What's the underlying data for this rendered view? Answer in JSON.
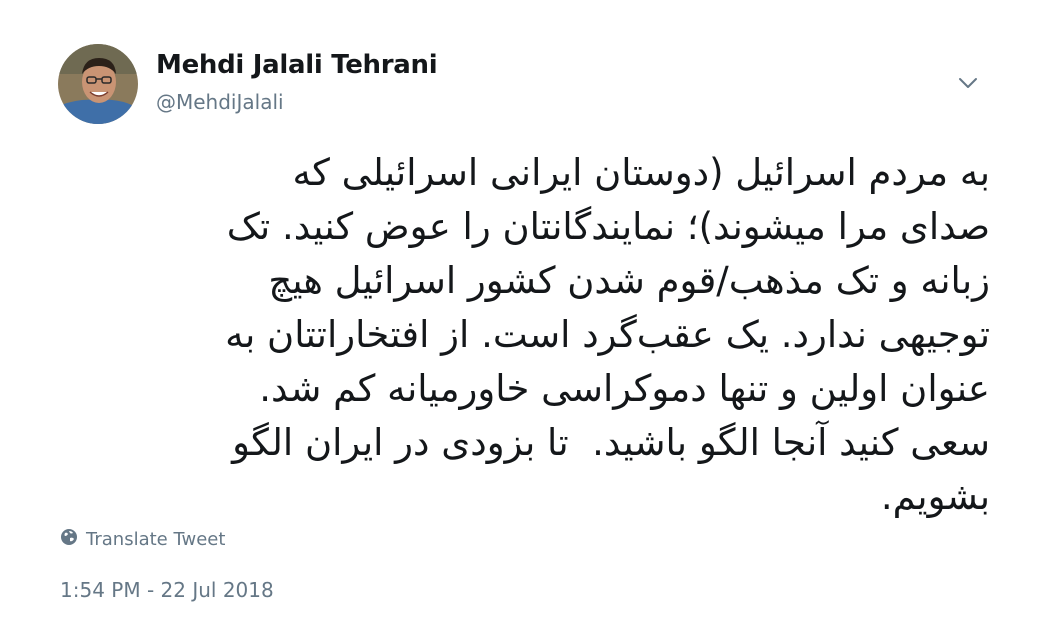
{
  "user": {
    "display_name": "Mehdi Jalali Tehrani",
    "handle": "@MehdiJalali"
  },
  "tweet": {
    "text": "به مردم اسرائیل (دوستان ایرانی اسرائیلی که\nصدای مرا میشوند)؛ نمایندگانتان را عوض کنید. تک\nزبانه و تک مذهب/قوم شدن کشور اسرائیل هیچ\nتوجیهی ندارد. یک عقب‌گرد است. از افتخاراتتان به\nعنوان اولین و تنها دموکراسی خاورمیانه کم شد.\nسعی کنید آنجا الگو باشید.  تا بزودی در ایران الگو\nبشویم.",
    "translate_label": "Translate Tweet",
    "timestamp": "1:54 PM - 22 Jul 2018"
  },
  "icons": {
    "caret": "chevron-down-icon",
    "translate": "globe-icon"
  },
  "colors": {
    "text": "#14171a",
    "secondary": "#657786",
    "background": "#ffffff"
  }
}
